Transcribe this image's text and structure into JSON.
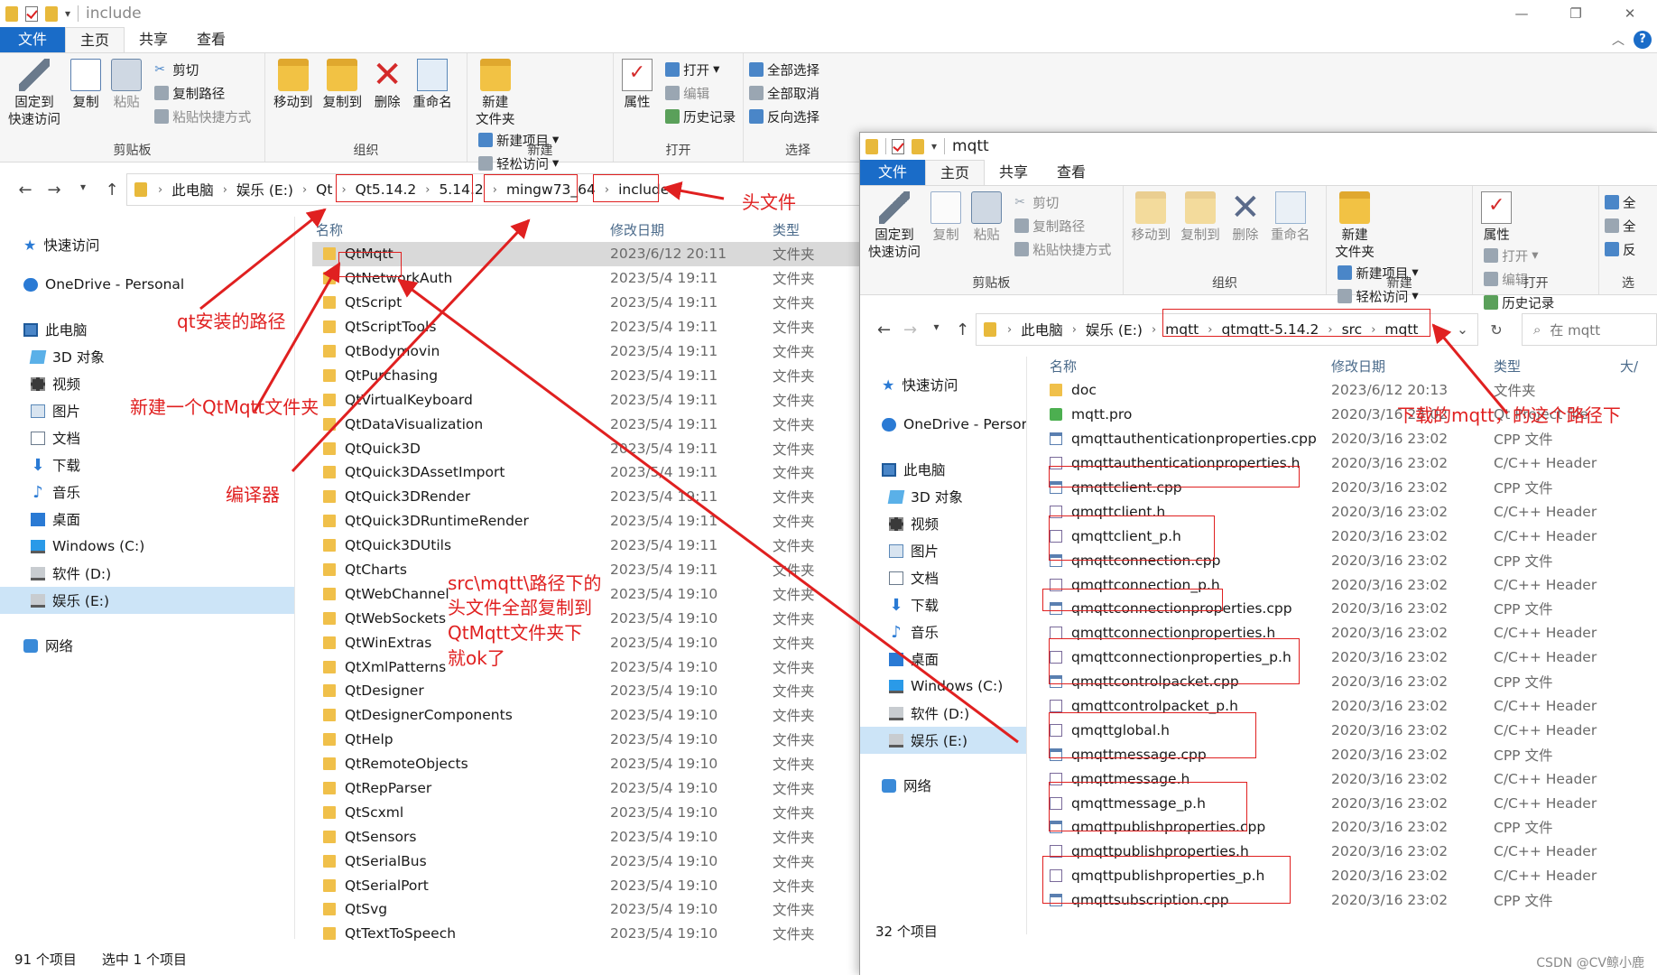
{
  "left_window": {
    "title": "include",
    "tabs": {
      "file": "文件",
      "home": "主页",
      "share": "共享",
      "view": "查看"
    },
    "ribbon": {
      "pin": "固定到\n快速访问",
      "copy": "复制",
      "paste": "粘贴",
      "cut": "剪切",
      "copy_path": "复制路径",
      "paste_shortcut": "粘贴快捷方式",
      "clipboard_group": "剪贴板",
      "move_to": "移动到",
      "copy_to": "复制到",
      "delete": "删除",
      "rename": "重命名",
      "organize_group": "组织",
      "new_folder": "新建\n文件夹",
      "new_item": "新建项目",
      "easy_access": "轻松访问",
      "new_group": "新建",
      "properties": "属性",
      "open": "打开",
      "edit": "编辑",
      "history": "历史记录",
      "open_group": "打开",
      "select_all": "全部选择",
      "select_none": "全部取消",
      "invert_select": "反向选择",
      "select_group": "选择"
    },
    "breadcrumb": [
      "此电脑",
      "娱乐 (E:)",
      "Qt",
      "Qt5.14.2",
      "5.14.2",
      "mingw73_64",
      "include"
    ],
    "nav": [
      {
        "label": "快速访问",
        "icon": "star-icon"
      },
      {
        "label": "OneDrive - Personal",
        "icon": "cloud-icon"
      },
      {
        "label": "此电脑",
        "icon": "computer-icon"
      },
      {
        "label": "3D 对象",
        "icon": "3d-objects-icon"
      },
      {
        "label": "视频",
        "icon": "video-icon"
      },
      {
        "label": "图片",
        "icon": "pictures-icon"
      },
      {
        "label": "文档",
        "icon": "documents-icon"
      },
      {
        "label": "下载",
        "icon": "download-icon"
      },
      {
        "label": "音乐",
        "icon": "music-icon"
      },
      {
        "label": "桌面",
        "icon": "desktop-icon"
      },
      {
        "label": "Windows (C:)",
        "icon": "windows-drive-icon"
      },
      {
        "label": "软件 (D:)",
        "icon": "drive-icon"
      },
      {
        "label": "娱乐 (E:)",
        "icon": "drive-icon"
      },
      {
        "label": "网络",
        "icon": "network-icon"
      }
    ],
    "columns": {
      "name": "名称",
      "date": "修改日期",
      "type": "类型"
    },
    "files": [
      {
        "name": "QtMqtt",
        "date": "2023/6/12 20:11",
        "type": "文件夹"
      },
      {
        "name": "QtNetworkAuth",
        "date": "2023/5/4 19:11",
        "type": "文件夹"
      },
      {
        "name": "QtScript",
        "date": "2023/5/4 19:11",
        "type": "文件夹"
      },
      {
        "name": "QtScriptTools",
        "date": "2023/5/4 19:11",
        "type": "文件夹"
      },
      {
        "name": "QtBodymovin",
        "date": "2023/5/4 19:11",
        "type": "文件夹"
      },
      {
        "name": "QtPurchasing",
        "date": "2023/5/4 19:11",
        "type": "文件夹"
      },
      {
        "name": "QtVirtualKeyboard",
        "date": "2023/5/4 19:11",
        "type": "文件夹"
      },
      {
        "name": "QtDataVisualization",
        "date": "2023/5/4 19:11",
        "type": "文件夹"
      },
      {
        "name": "QtQuick3D",
        "date": "2023/5/4 19:11",
        "type": "文件夹"
      },
      {
        "name": "QtQuick3DAssetImport",
        "date": "2023/5/4 19:11",
        "type": "文件夹"
      },
      {
        "name": "QtQuick3DRender",
        "date": "2023/5/4 19:11",
        "type": "文件夹"
      },
      {
        "name": "QtQuick3DRuntimeRender",
        "date": "2023/5/4 19:11",
        "type": "文件夹"
      },
      {
        "name": "QtQuick3DUtils",
        "date": "2023/5/4 19:11",
        "type": "文件夹"
      },
      {
        "name": "QtCharts",
        "date": "2023/5/4 19:11",
        "type": "文件夹"
      },
      {
        "name": "QtWebChannel",
        "date": "2023/5/4 19:10",
        "type": "文件夹"
      },
      {
        "name": "QtWebSockets",
        "date": "2023/5/4 19:10",
        "type": "文件夹"
      },
      {
        "name": "QtWinExtras",
        "date": "2023/5/4 19:10",
        "type": "文件夹"
      },
      {
        "name": "QtXmlPatterns",
        "date": "2023/5/4 19:10",
        "type": "文件夹"
      },
      {
        "name": "QtDesigner",
        "date": "2023/5/4 19:10",
        "type": "文件夹"
      },
      {
        "name": "QtDesignerComponents",
        "date": "2023/5/4 19:10",
        "type": "文件夹"
      },
      {
        "name": "QtHelp",
        "date": "2023/5/4 19:10",
        "type": "文件夹"
      },
      {
        "name": "QtRemoteObjects",
        "date": "2023/5/4 19:10",
        "type": "文件夹"
      },
      {
        "name": "QtRepParser",
        "date": "2023/5/4 19:10",
        "type": "文件夹"
      },
      {
        "name": "QtScxml",
        "date": "2023/5/4 19:10",
        "type": "文件夹"
      },
      {
        "name": "QtSensors",
        "date": "2023/5/4 19:10",
        "type": "文件夹"
      },
      {
        "name": "QtSerialBus",
        "date": "2023/5/4 19:10",
        "type": "文件夹"
      },
      {
        "name": "QtSerialPort",
        "date": "2023/5/4 19:10",
        "type": "文件夹"
      },
      {
        "name": "QtSvg",
        "date": "2023/5/4 19:10",
        "type": "文件夹"
      },
      {
        "name": "QtTextToSpeech",
        "date": "2023/5/4 19:10",
        "type": "文件夹"
      }
    ],
    "status": {
      "count": "91 个项目",
      "selected": "选中 1 个项目"
    }
  },
  "right_window": {
    "title": "mqtt",
    "tabs": {
      "file": "文件",
      "home": "主页",
      "share": "共享",
      "view": "查看"
    },
    "ribbon": {
      "pin": "固定到\n快速访问",
      "copy": "复制",
      "paste": "粘贴",
      "cut": "剪切",
      "copy_path": "复制路径",
      "paste_shortcut": "粘贴快捷方式",
      "clipboard_group": "剪贴板",
      "move_to": "移动到",
      "copy_to": "复制到",
      "delete": "删除",
      "rename": "重命名",
      "organize_group": "组织",
      "new_folder": "新建\n文件夹",
      "new_item": "新建项目",
      "easy_access": "轻松访问",
      "new_group": "新建",
      "properties": "属性",
      "open": "打开",
      "edit": "编辑",
      "history": "历史记录",
      "open_group": "打开",
      "select_all": "全",
      "select_none": "全",
      "invert_select": "反",
      "select_group": "选"
    },
    "breadcrumb": [
      "此电脑",
      "娱乐 (E:)",
      "mqtt",
      "qtmqtt-5.14.2",
      "src",
      "mqtt"
    ],
    "search_placeholder": "在 mqtt",
    "nav": [
      {
        "label": "快速访问",
        "icon": "star-icon"
      },
      {
        "label": "OneDrive - Persor",
        "icon": "cloud-icon"
      },
      {
        "label": "此电脑",
        "icon": "computer-icon"
      },
      {
        "label": "3D 对象",
        "icon": "3d-objects-icon"
      },
      {
        "label": "视频",
        "icon": "video-icon"
      },
      {
        "label": "图片",
        "icon": "pictures-icon"
      },
      {
        "label": "文档",
        "icon": "documents-icon"
      },
      {
        "label": "下载",
        "icon": "download-icon"
      },
      {
        "label": "音乐",
        "icon": "music-icon"
      },
      {
        "label": "桌面",
        "icon": "desktop-icon"
      },
      {
        "label": "Windows (C:)",
        "icon": "windows-drive-icon"
      },
      {
        "label": "软件 (D:)",
        "icon": "drive-icon"
      },
      {
        "label": "娱乐 (E:)",
        "icon": "drive-icon"
      },
      {
        "label": "网络",
        "icon": "network-icon"
      }
    ],
    "columns": {
      "name": "名称",
      "date": "修改日期",
      "type": "类型",
      "size": "大/"
    },
    "files": [
      {
        "name": "doc",
        "date": "2023/6/12 20:13",
        "type": "文件夹",
        "kind": "folder"
      },
      {
        "name": "mqtt.pro",
        "date": "2020/3/16 23:02",
        "type": "Qt Project file",
        "kind": "pro"
      },
      {
        "name": "qmqttauthenticationproperties.cpp",
        "date": "2020/3/16 23:02",
        "type": "CPP 文件",
        "kind": "cpp"
      },
      {
        "name": "qmqttauthenticationproperties.h",
        "date": "2020/3/16 23:02",
        "type": "C/C++ Header",
        "kind": "h"
      },
      {
        "name": "qmqttclient.cpp",
        "date": "2020/3/16 23:02",
        "type": "CPP 文件",
        "kind": "cpp"
      },
      {
        "name": "qmqttclient.h",
        "date": "2020/3/16 23:02",
        "type": "C/C++ Header",
        "kind": "h"
      },
      {
        "name": "qmqttclient_p.h",
        "date": "2020/3/16 23:02",
        "type": "C/C++ Header",
        "kind": "h"
      },
      {
        "name": "qmqttconnection.cpp",
        "date": "2020/3/16 23:02",
        "type": "CPP 文件",
        "kind": "cpp"
      },
      {
        "name": "qmqttconnection_p.h",
        "date": "2020/3/16 23:02",
        "type": "C/C++ Header",
        "kind": "h"
      },
      {
        "name": "qmqttconnectionproperties.cpp",
        "date": "2020/3/16 23:02",
        "type": "CPP 文件",
        "kind": "cpp"
      },
      {
        "name": "qmqttconnectionproperties.h",
        "date": "2020/3/16 23:02",
        "type": "C/C++ Header",
        "kind": "h"
      },
      {
        "name": "qmqttconnectionproperties_p.h",
        "date": "2020/3/16 23:02",
        "type": "C/C++ Header",
        "kind": "h"
      },
      {
        "name": "qmqttcontrolpacket.cpp",
        "date": "2020/3/16 23:02",
        "type": "CPP 文件",
        "kind": "cpp"
      },
      {
        "name": "qmqttcontrolpacket_p.h",
        "date": "2020/3/16 23:02",
        "type": "C/C++ Header",
        "kind": "h"
      },
      {
        "name": "qmqttglobal.h",
        "date": "2020/3/16 23:02",
        "type": "C/C++ Header",
        "kind": "h"
      },
      {
        "name": "qmqttmessage.cpp",
        "date": "2020/3/16 23:02",
        "type": "CPP 文件",
        "kind": "cpp"
      },
      {
        "name": "qmqttmessage.h",
        "date": "2020/3/16 23:02",
        "type": "C/C++ Header",
        "kind": "h"
      },
      {
        "name": "qmqttmessage_p.h",
        "date": "2020/3/16 23:02",
        "type": "C/C++ Header",
        "kind": "h"
      },
      {
        "name": "qmqttpublishproperties.cpp",
        "date": "2020/3/16 23:02",
        "type": "CPP 文件",
        "kind": "cpp"
      },
      {
        "name": "qmqttpublishproperties.h",
        "date": "2020/3/16 23:02",
        "type": "C/C++ Header",
        "kind": "h"
      },
      {
        "name": "qmqttpublishproperties_p.h",
        "date": "2020/3/16 23:02",
        "type": "C/C++ Header",
        "kind": "h"
      },
      {
        "name": "qmqttsubscription.cpp",
        "date": "2020/3/16 23:02",
        "type": "CPP 文件",
        "kind": "cpp"
      }
    ],
    "status": {
      "count": "32 个项目"
    }
  },
  "annotations": {
    "qt_install_path": "qt安装的路径",
    "new_qtmqtt_folder": "新建一个QtMqtt文件夹",
    "compiler": "编译器",
    "header_files": "头文件",
    "copy_instruction_1": "src\\mqtt\\路径下的",
    "copy_instruction_2": "头文件全部复制到",
    "copy_instruction_3": "QtMqtt文件夹下",
    "copy_instruction_4": "就ok了",
    "download_path": "下载的mqtt，的这个路径下",
    "color": "#e02020"
  },
  "watermark": "CSDN @CV鲸小鹿"
}
